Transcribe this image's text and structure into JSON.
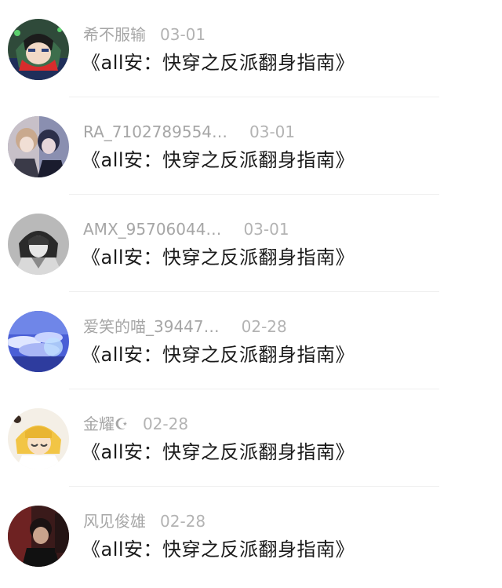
{
  "comments": [
    {
      "username": "希不服输",
      "date": "03-01",
      "text": "《all安：快穿之反派翻身指南》",
      "avatar_icon": "avatar-green-hood"
    },
    {
      "username": "RA_7102789554…",
      "date": "03-01",
      "text": "《all安：快穿之反派翻身指南》",
      "avatar_icon": "avatar-anime-duo"
    },
    {
      "username": "AMX_95706044…",
      "date": "03-01",
      "text": "《all安：快穿之反派翻身指南》",
      "avatar_icon": "avatar-grey-sketch"
    },
    {
      "username": "爱笑的喵_39447…",
      "date": "02-28",
      "text": "《all安：快穿之反派翻身指南》",
      "avatar_icon": "avatar-blue-sky"
    },
    {
      "username": "金耀☪",
      "date": "02-28",
      "text": "《all安：快穿之反派翻身指南》",
      "avatar_icon": "avatar-blonde-anime"
    },
    {
      "username": "风见俊雄",
      "date": "02-28",
      "text": "《all安：快穿之反派翻身指南》",
      "avatar_icon": "avatar-dark-photo"
    }
  ],
  "colors": {
    "username": "#a6a6a6",
    "date": "#b3b3b3",
    "text": "#1a1a1a",
    "divider": "#efefef",
    "background": "#ffffff"
  }
}
